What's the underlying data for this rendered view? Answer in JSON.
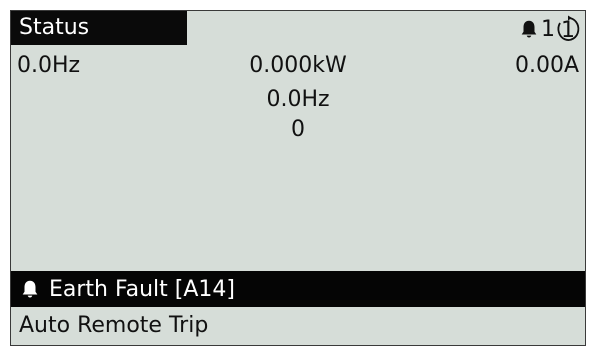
{
  "header": {
    "title": "Status",
    "alarm_icon": "bell-icon",
    "alarm_count": "1",
    "alarm_circled": "1"
  },
  "readings": {
    "frequency_left": "0.0Hz",
    "power": "0.000kW",
    "current": "0.00A",
    "frequency_center": "0.0Hz",
    "value": "0"
  },
  "fault": {
    "icon": "bell-icon",
    "text": "Earth Fault [A14]"
  },
  "status": {
    "text": "Auto Remote Trip"
  },
  "colors": {
    "display_background": "#d6ddd8",
    "highlight_bar": "#050505",
    "highlight_text": "#ffffff"
  }
}
